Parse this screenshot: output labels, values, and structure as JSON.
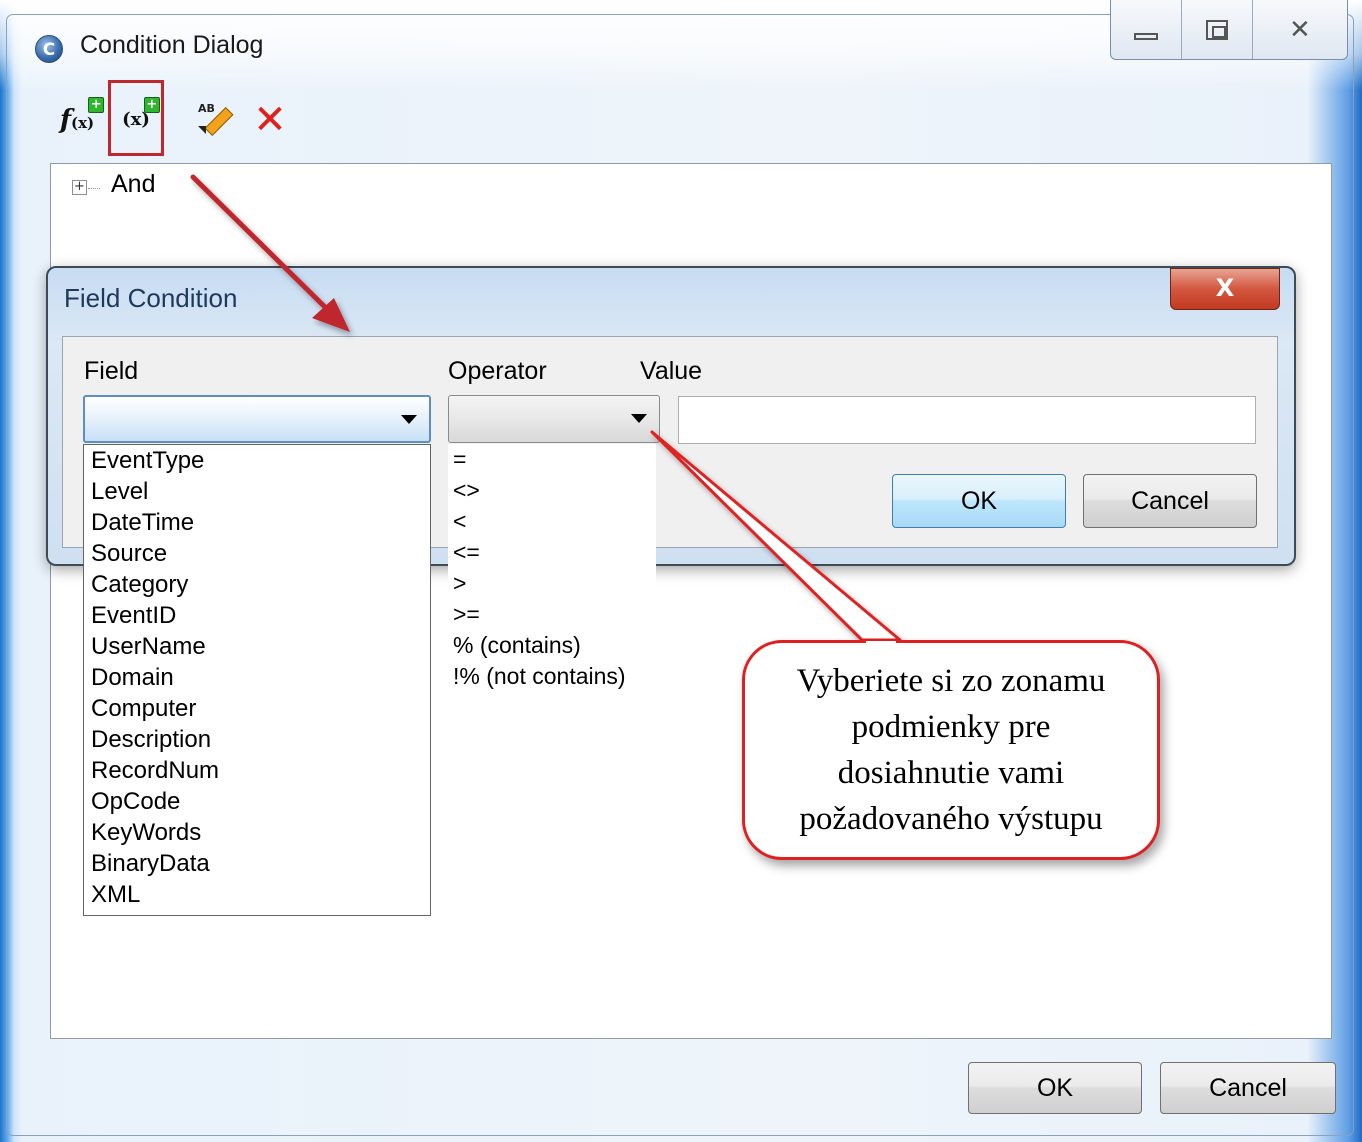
{
  "outer_window": {
    "title": "Condition Dialog",
    "app_icon_letter": "C",
    "controls": {
      "minimize": "minimize",
      "maximize": "maximize",
      "close": "close"
    },
    "ok_label": "OK",
    "cancel_label": "Cancel"
  },
  "toolbar": {
    "items": [
      {
        "name": "add-function",
        "icon": "function-add-icon"
      },
      {
        "name": "add-field",
        "icon": "field-add-icon",
        "highlighted": true
      },
      {
        "name": "rename",
        "icon": "rename-pencil-icon"
      },
      {
        "name": "delete",
        "icon": "delete-x-icon"
      }
    ]
  },
  "tree": {
    "root_label": "And",
    "expanded": false
  },
  "field_condition": {
    "title": "Field Condition",
    "close_glyph": "X",
    "field_label": "Field",
    "operator_label": "Operator",
    "value_label": "Value",
    "field_value": "",
    "operator_value": "",
    "value_value": "",
    "ok_label": "OK",
    "cancel_label": "Cancel",
    "field_options": [
      "EventType",
      "Level",
      "DateTime",
      "Source",
      "Category",
      "EventID",
      "UserName",
      "Domain",
      "Computer",
      "Description",
      "RecordNum",
      "OpCode",
      "KeyWords",
      "BinaryData",
      "XML"
    ],
    "operator_options": [
      "=",
      "<>",
      "<",
      "<=",
      ">",
      ">=",
      "% (contains)",
      "!% (not contains)"
    ]
  },
  "annotation": {
    "callout_text": "Vyberiete si zo zonamu\npodmienky pre\ndosiahnutie vami\npožadovaného výstupu",
    "color": "#e02020"
  },
  "colors": {
    "accent_red": "#c0272d",
    "callout_border": "#e02020",
    "title_bar_blue": "#c7dcf2"
  }
}
